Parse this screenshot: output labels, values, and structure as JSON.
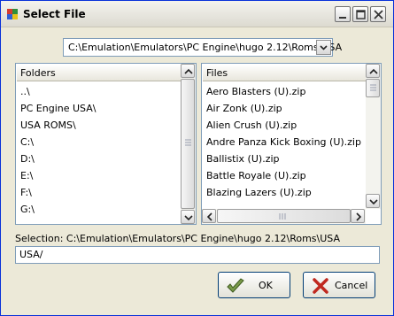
{
  "window": {
    "title": "Select File"
  },
  "path_combo": {
    "value": "C:\\Emulation\\Emulators\\PC Engine\\hugo 2.12\\Roms\\USA"
  },
  "folders": {
    "header": "Folders",
    "items": [
      "..\\",
      "PC Engine USA\\",
      "USA ROMS\\",
      "C:\\",
      "D:\\",
      "E:\\",
      "F:\\",
      "G:\\"
    ]
  },
  "files": {
    "header": "Files",
    "items": [
      "Aero Blasters (U).zip",
      "Air Zonk (U).zip",
      "Alien Crush (U).zip",
      "Andre Panza Kick Boxing (U).zip",
      "Ballistix (U).zip",
      "Battle Royale (U).zip",
      "Blazing Lazers (U).zip"
    ]
  },
  "selection": {
    "label": "Selection: C:\\Emulation\\Emulators\\PC Engine\\hugo 2.12\\Roms\\USA",
    "value": "USA/"
  },
  "buttons": {
    "ok_label": "OK",
    "cancel_label": "Cancel"
  }
}
